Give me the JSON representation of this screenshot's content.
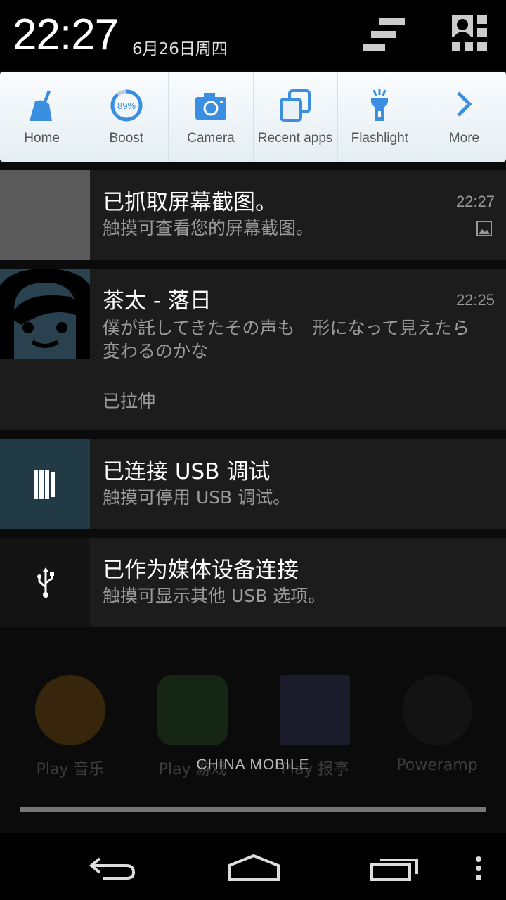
{
  "header": {
    "time": "22:27",
    "date": "6月26日周四",
    "icons": [
      "notification-settings-icon",
      "quick-settings-user-icon"
    ]
  },
  "quick_panel": {
    "accent": "#3b8fe0",
    "tiles": [
      {
        "label": "Home",
        "icon": "broom-icon"
      },
      {
        "label": "Boost",
        "icon": "boost-gauge-icon",
        "value": "89%",
        "percent": 89
      },
      {
        "label": "Camera",
        "icon": "camera-icon"
      },
      {
        "label": "Recent apps",
        "icon": "recent-apps-icon"
      },
      {
        "label": "Flashlight",
        "icon": "flashlight-icon"
      },
      {
        "label": "More",
        "icon": "chevron-right-icon"
      }
    ]
  },
  "notifications": [
    {
      "title": "已抓取屏幕截图。",
      "text": "触摸可查看您的屏幕截图。",
      "time": "22:27",
      "icon": "image-icon"
    },
    {
      "title": "茶太 - 落日",
      "text": "僕が託してきたその声も　形になって見えたら変わるのかな",
      "time": "22:25",
      "action": "已拉伸",
      "icon": "headphone-girl-icon"
    },
    {
      "title": "已连接 USB 调试",
      "text": "触摸可停用 USB 调试。",
      "icon": "usb-debug-icon"
    },
    {
      "title": "已作为媒体设备连接",
      "text": "触摸可显示其他 USB 选项。",
      "icon": "usb-icon"
    }
  ],
  "background_apps": [
    "Play 音乐",
    "Play 游戏",
    "Play 报亭",
    "Poweramp"
  ],
  "carrier": "CHINA  MOBILE",
  "nav": {
    "icons": [
      "back-icon",
      "home-icon",
      "recents-icon",
      "menu-icon"
    ]
  }
}
